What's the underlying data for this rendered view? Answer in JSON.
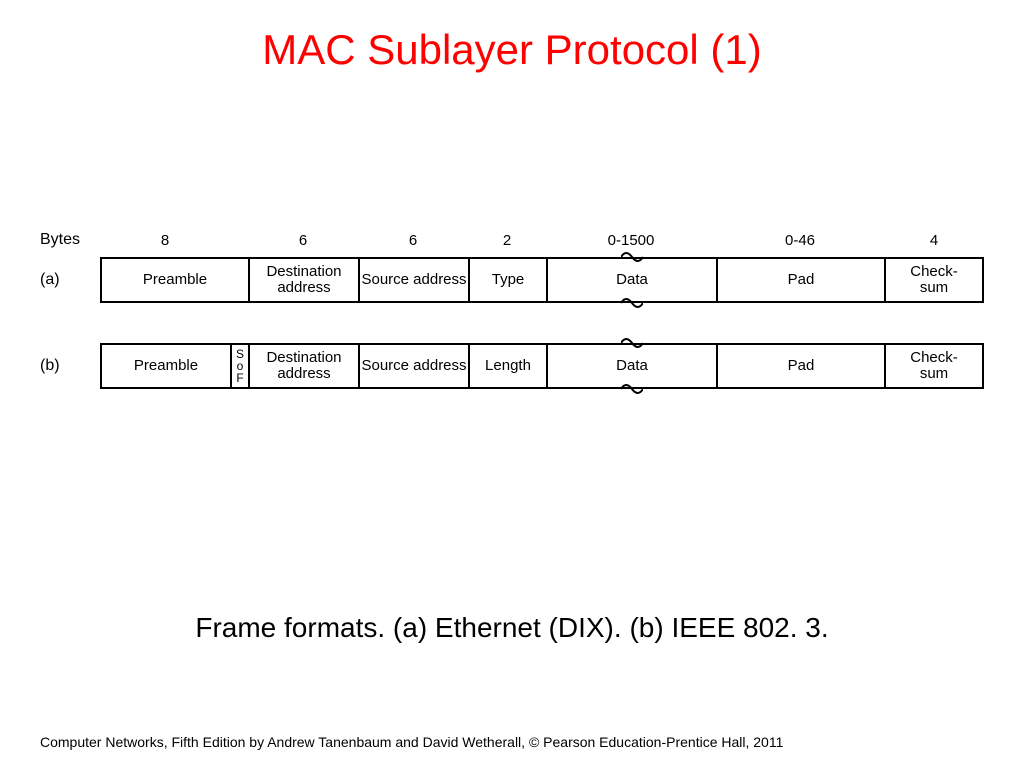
{
  "title": "MAC Sublayer Protocol (1)",
  "bytes_label": "Bytes",
  "byte_counts": [
    "8",
    "6",
    "6",
    "2",
    "0-1500",
    "0-46",
    "4"
  ],
  "row_a": {
    "label": "(a)",
    "fields": {
      "preamble": "Preamble",
      "dest": "Destination address",
      "src": "Source address",
      "type": "Type",
      "data": "Data",
      "pad": "Pad",
      "checksum": "Check-\nsum"
    }
  },
  "row_b": {
    "label": "(b)",
    "fields": {
      "preamble": "Preamble",
      "sof0": "S",
      "sof1": "o",
      "sof2": "F",
      "dest": "Destination address",
      "src": "Source address",
      "length": "Length",
      "data": "Data",
      "pad": "Pad",
      "checksum": "Check-\nsum"
    }
  },
  "caption": "Frame formats. (a) Ethernet (DIX). (b) IEEE 802. 3.",
  "footer": "Computer Networks, Fifth Edition by Andrew Tanenbaum and David Wetherall, © Pearson Education-Prentice Hall, 2011"
}
